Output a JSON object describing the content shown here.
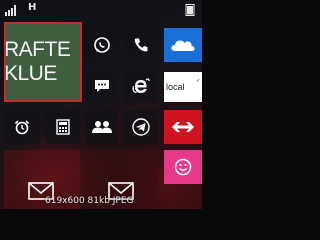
{
  "status_bar": {
    "network_type": "H",
    "signal_icon": "signal-strength-icon",
    "battery_icon": "battery-icon"
  },
  "start_screen": {
    "live_tile": {
      "lines": [
        "RAFTE",
        "KLUE"
      ],
      "border_color": "#cc2a2a",
      "background": "#3f5d3f"
    },
    "tiles": [
      {
        "name": "whatsapp-tile",
        "icon": "whatsapp-icon"
      },
      {
        "name": "phone-tile",
        "icon": "phone-icon"
      },
      {
        "name": "onedrive-tile",
        "icon": "cloud-icon",
        "color": "#1b6fd8"
      },
      {
        "name": "messaging-tile",
        "icon": "messaging-icon"
      },
      {
        "name": "internet-explorer-tile",
        "icon": "internet-explorer-icon"
      },
      {
        "name": "local-weather-tile",
        "label": "local"
      },
      {
        "name": "alarms-tile",
        "icon": "alarm-clock-icon"
      },
      {
        "name": "calculator-tile",
        "icon": "calculator-icon"
      },
      {
        "name": "people-tile",
        "icon": "people-icon"
      },
      {
        "name": "telegram-tile",
        "icon": "telegram-icon"
      },
      {
        "name": "sbb-tile",
        "icon": "swiss-rail-icon",
        "color": "#cf1420"
      },
      {
        "name": "smiley-tile",
        "icon": "smiley-icon",
        "color": "#e6398a"
      },
      {
        "name": "mail-tile",
        "icon": "mail-icon"
      },
      {
        "name": "outlook-mail-tile",
        "icon": "mail-icon"
      }
    ]
  },
  "footer_caption": "619x600  81kb  JPEG"
}
